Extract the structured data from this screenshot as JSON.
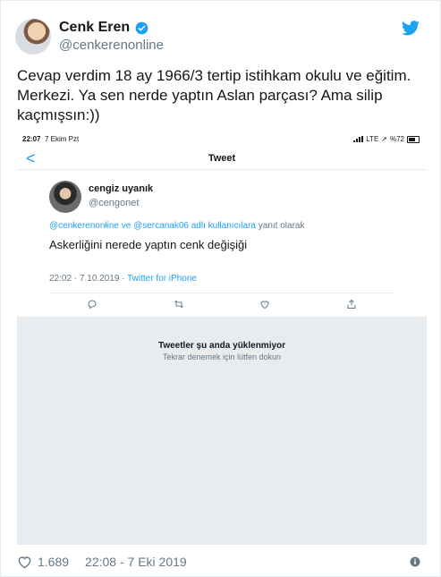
{
  "user": {
    "name": "Cenk Eren",
    "handle": "@cenkerenonline"
  },
  "tweet": {
    "lines": [
      "Cevap verdim 18 ay 1966/3 tertip istihkam okulu ve eğitim.",
      "Merkezi. Ya sen nerde yaptın Aslan parçası? Ama silip",
      "kaçmışsın:))"
    ]
  },
  "screenshot": {
    "status": {
      "time": "22:07",
      "date": "7 Ekim Pzt",
      "network": "LTE",
      "battery": "%72"
    },
    "nav": {
      "back": "<",
      "title": "Tweet"
    },
    "inner_tweet": {
      "name": "cengiz uyanık",
      "handle": "@cengonet",
      "reply_mentions": "@cenkerenonline ve @sercanak06 adlı kullanıcılara",
      "reply_suffix": "yanıt olarak",
      "text": "Askerliğini nerede yaptın cenk değişiği",
      "datetime": "22:02 · 7.10.2019 ·",
      "client": "Twitter for iPhone"
    },
    "unavailable": {
      "title": "Tweetler şu anda yüklenmiyor",
      "subtitle": "Tekrar denemek için lütfen dokun"
    }
  },
  "footer": {
    "likes": "1.689",
    "timestamp": "22:08 - 7 Eki 2019"
  },
  "colors": {
    "accent": "#1da1f2",
    "text": "#14171a",
    "muted": "#657786"
  },
  "icons": [
    "verified-badge-icon",
    "twitter-bird-icon",
    "back-icon",
    "reply-icon",
    "retweet-icon",
    "like-icon",
    "share-icon",
    "heart-icon",
    "info-icon"
  ]
}
